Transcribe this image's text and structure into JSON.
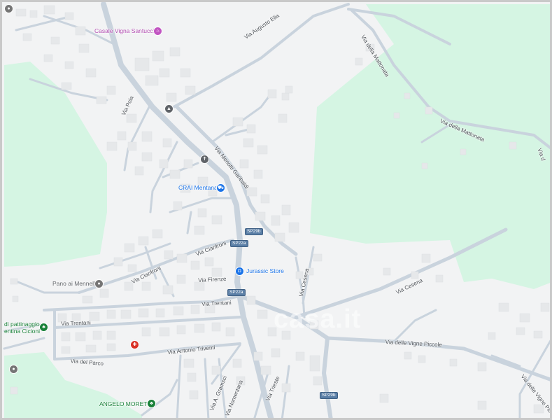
{
  "map": {
    "colors": {
      "background": "#f2f3f4",
      "park": "#d5f5e3",
      "road": "#c9d3dd",
      "building": "#e6e8ea"
    },
    "streets": [
      {
        "id": "via-augusto-elia",
        "text": "Via Augusto Elia"
      },
      {
        "id": "via-della-mattonata-1",
        "text": "Via della Mattonata"
      },
      {
        "id": "via-della-mattonata-2",
        "text": "Via della Mattonata"
      },
      {
        "id": "via-della-mattonata-3",
        "text": "Via d"
      },
      {
        "id": "via-pola",
        "text": "Via Pola"
      },
      {
        "id": "via-menotti-garibaldi",
        "text": "Via Menotti Garibaldi"
      },
      {
        "id": "via-cianfroni-1",
        "text": "Via Cianfroni"
      },
      {
        "id": "via-cianfroni-2",
        "text": "Via Cianfroni"
      },
      {
        "id": "via-cesena-1",
        "text": "Via Cesena"
      },
      {
        "id": "via-cesena-2",
        "text": "Via Cesena"
      },
      {
        "id": "via-firenze",
        "text": "Via Firenze"
      },
      {
        "id": "via-trentani-1",
        "text": "Via Trentani"
      },
      {
        "id": "via-trentani-2",
        "text": "Via Trentani"
      },
      {
        "id": "via-antonio-triventi",
        "text": "Via Antonio Triventi"
      },
      {
        "id": "via-del-parco",
        "text": "Via del Parco"
      },
      {
        "id": "via-delle-vigne-piccole-1",
        "text": "Via delle Vigne Piccole"
      },
      {
        "id": "via-delle-vigne-piccole-2",
        "text": "Via delle Vigne Picc"
      },
      {
        "id": "via-a-gramsci",
        "text": "Via A. Gramsci"
      },
      {
        "id": "via-nomentana",
        "text": "Via Nomentana"
      },
      {
        "id": "via-trieste",
        "text": "Via Trieste"
      }
    ],
    "shields": [
      {
        "id": "sp29b-top",
        "text": "SP29b"
      },
      {
        "id": "sp22a-1",
        "text": "SP22a"
      },
      {
        "id": "sp22a-2",
        "text": "SP22a"
      },
      {
        "id": "sp29b-bottom",
        "text": "SP29b"
      }
    ],
    "pois": [
      {
        "id": "casale-vigna-santucci",
        "text": "Casale Vigna Santucci",
        "icon": "lodging-icon",
        "color": "#c154c1"
      },
      {
        "id": "crai-mentana",
        "text": "CRAI Mentana",
        "icon": "shopping-cart-icon",
        "color": "#1a73e8"
      },
      {
        "id": "jurassic-store",
        "text": "Jurassic Store",
        "icon": "shopping-bag-icon",
        "color": "#1a73e8"
      },
      {
        "id": "pano-ai-mennelli",
        "text": "Pano ai Mennelli",
        "icon": "place-icon",
        "color": "#757575"
      },
      {
        "id": "pattinaggio",
        "text": "di pattinaggio\nentina Cicioni",
        "icon": "park-icon",
        "color": "#188038"
      },
      {
        "id": "angelo-moretti",
        "text": "ANGELO MORETTI",
        "icon": "park-icon",
        "color": "#188038"
      },
      {
        "id": "school",
        "text": "",
        "icon": "school-icon",
        "color": "#5f6368"
      },
      {
        "id": "church",
        "text": "",
        "icon": "church-icon",
        "color": "#5f6368"
      },
      {
        "id": "hospital",
        "text": "",
        "icon": "hospital-icon",
        "color": "#d93025"
      }
    ],
    "watermark": "casa.it"
  }
}
